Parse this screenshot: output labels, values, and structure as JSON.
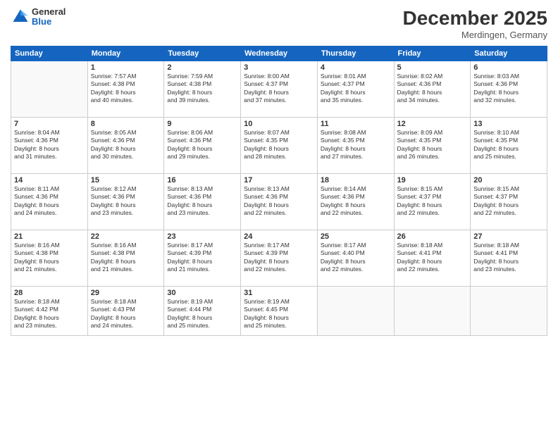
{
  "logo": {
    "general": "General",
    "blue": "Blue"
  },
  "header": {
    "month": "December 2025",
    "location": "Merdingen, Germany"
  },
  "weekdays": [
    "Sunday",
    "Monday",
    "Tuesday",
    "Wednesday",
    "Thursday",
    "Friday",
    "Saturday"
  ],
  "weeks": [
    [
      {
        "day": "",
        "info": ""
      },
      {
        "day": "1",
        "info": "Sunrise: 7:57 AM\nSunset: 4:38 PM\nDaylight: 8 hours\nand 40 minutes."
      },
      {
        "day": "2",
        "info": "Sunrise: 7:59 AM\nSunset: 4:38 PM\nDaylight: 8 hours\nand 39 minutes."
      },
      {
        "day": "3",
        "info": "Sunrise: 8:00 AM\nSunset: 4:37 PM\nDaylight: 8 hours\nand 37 minutes."
      },
      {
        "day": "4",
        "info": "Sunrise: 8:01 AM\nSunset: 4:37 PM\nDaylight: 8 hours\nand 35 minutes."
      },
      {
        "day": "5",
        "info": "Sunrise: 8:02 AM\nSunset: 4:36 PM\nDaylight: 8 hours\nand 34 minutes."
      },
      {
        "day": "6",
        "info": "Sunrise: 8:03 AM\nSunset: 4:36 PM\nDaylight: 8 hours\nand 32 minutes."
      }
    ],
    [
      {
        "day": "7",
        "info": "Sunrise: 8:04 AM\nSunset: 4:36 PM\nDaylight: 8 hours\nand 31 minutes."
      },
      {
        "day": "8",
        "info": "Sunrise: 8:05 AM\nSunset: 4:36 PM\nDaylight: 8 hours\nand 30 minutes."
      },
      {
        "day": "9",
        "info": "Sunrise: 8:06 AM\nSunset: 4:36 PM\nDaylight: 8 hours\nand 29 minutes."
      },
      {
        "day": "10",
        "info": "Sunrise: 8:07 AM\nSunset: 4:35 PM\nDaylight: 8 hours\nand 28 minutes."
      },
      {
        "day": "11",
        "info": "Sunrise: 8:08 AM\nSunset: 4:35 PM\nDaylight: 8 hours\nand 27 minutes."
      },
      {
        "day": "12",
        "info": "Sunrise: 8:09 AM\nSunset: 4:35 PM\nDaylight: 8 hours\nand 26 minutes."
      },
      {
        "day": "13",
        "info": "Sunrise: 8:10 AM\nSunset: 4:35 PM\nDaylight: 8 hours\nand 25 minutes."
      }
    ],
    [
      {
        "day": "14",
        "info": "Sunrise: 8:11 AM\nSunset: 4:36 PM\nDaylight: 8 hours\nand 24 minutes."
      },
      {
        "day": "15",
        "info": "Sunrise: 8:12 AM\nSunset: 4:36 PM\nDaylight: 8 hours\nand 23 minutes."
      },
      {
        "day": "16",
        "info": "Sunrise: 8:13 AM\nSunset: 4:36 PM\nDaylight: 8 hours\nand 23 minutes."
      },
      {
        "day": "17",
        "info": "Sunrise: 8:13 AM\nSunset: 4:36 PM\nDaylight: 8 hours\nand 22 minutes."
      },
      {
        "day": "18",
        "info": "Sunrise: 8:14 AM\nSunset: 4:36 PM\nDaylight: 8 hours\nand 22 minutes."
      },
      {
        "day": "19",
        "info": "Sunrise: 8:15 AM\nSunset: 4:37 PM\nDaylight: 8 hours\nand 22 minutes."
      },
      {
        "day": "20",
        "info": "Sunrise: 8:15 AM\nSunset: 4:37 PM\nDaylight: 8 hours\nand 22 minutes."
      }
    ],
    [
      {
        "day": "21",
        "info": "Sunrise: 8:16 AM\nSunset: 4:38 PM\nDaylight: 8 hours\nand 21 minutes."
      },
      {
        "day": "22",
        "info": "Sunrise: 8:16 AM\nSunset: 4:38 PM\nDaylight: 8 hours\nand 21 minutes."
      },
      {
        "day": "23",
        "info": "Sunrise: 8:17 AM\nSunset: 4:39 PM\nDaylight: 8 hours\nand 21 minutes."
      },
      {
        "day": "24",
        "info": "Sunrise: 8:17 AM\nSunset: 4:39 PM\nDaylight: 8 hours\nand 22 minutes."
      },
      {
        "day": "25",
        "info": "Sunrise: 8:17 AM\nSunset: 4:40 PM\nDaylight: 8 hours\nand 22 minutes."
      },
      {
        "day": "26",
        "info": "Sunrise: 8:18 AM\nSunset: 4:41 PM\nDaylight: 8 hours\nand 22 minutes."
      },
      {
        "day": "27",
        "info": "Sunrise: 8:18 AM\nSunset: 4:41 PM\nDaylight: 8 hours\nand 23 minutes."
      }
    ],
    [
      {
        "day": "28",
        "info": "Sunrise: 8:18 AM\nSunset: 4:42 PM\nDaylight: 8 hours\nand 23 minutes."
      },
      {
        "day": "29",
        "info": "Sunrise: 8:18 AM\nSunset: 4:43 PM\nDaylight: 8 hours\nand 24 minutes."
      },
      {
        "day": "30",
        "info": "Sunrise: 8:19 AM\nSunset: 4:44 PM\nDaylight: 8 hours\nand 25 minutes."
      },
      {
        "day": "31",
        "info": "Sunrise: 8:19 AM\nSunset: 4:45 PM\nDaylight: 8 hours\nand 25 minutes."
      },
      {
        "day": "",
        "info": ""
      },
      {
        "day": "",
        "info": ""
      },
      {
        "day": "",
        "info": ""
      }
    ]
  ]
}
